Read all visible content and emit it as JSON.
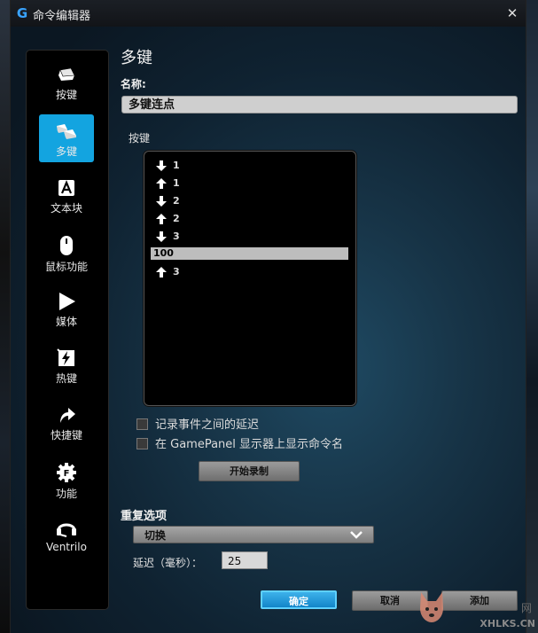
{
  "window": {
    "title": "命令编辑器",
    "close_glyph": "✕",
    "logo_glyph": "G"
  },
  "sidebar": {
    "items": [
      {
        "label": "按键",
        "icon": "key-icon",
        "active": false
      },
      {
        "label": "多键",
        "icon": "multikey-icon",
        "active": true
      },
      {
        "label": "文本块",
        "icon": "text-block-icon",
        "active": false
      },
      {
        "label": "鼠标功能",
        "icon": "mouse-icon",
        "active": false
      },
      {
        "label": "媒体",
        "icon": "play-icon",
        "active": false
      },
      {
        "label": "热键",
        "icon": "hotkey-icon",
        "active": false
      },
      {
        "label": "快捷键",
        "icon": "shortcut-arrow-icon",
        "active": false
      },
      {
        "label": "功能",
        "icon": "function-gear-icon",
        "active": false
      },
      {
        "label": "Ventrilo",
        "icon": "headset-icon",
        "active": false
      }
    ]
  },
  "main": {
    "section_title": "多键",
    "name_label": "名称:",
    "name_value": "多键连点",
    "keys_label": "按键",
    "keys": [
      {
        "dir": "down",
        "key": "1"
      },
      {
        "dir": "up",
        "key": "1"
      },
      {
        "dir": "down",
        "key": "2"
      },
      {
        "dir": "up",
        "key": "2"
      },
      {
        "dir": "down",
        "key": "3"
      },
      {
        "dir": "delay",
        "key": "100"
      },
      {
        "dir": "up",
        "key": "3"
      }
    ],
    "checkbox_record_delay": "记录事件之间的延迟",
    "checkbox_show_name": "在 GamePanel 显示器上显示命令名",
    "record_button": "开始录制",
    "repeat_label": "重复选项",
    "repeat_value": "切换",
    "delay_label": "延迟（毫秒）：",
    "delay_value": "25"
  },
  "footer": {
    "ok": "确定",
    "cancel": "取消",
    "add": "添加"
  },
  "watermark": {
    "top": "网",
    "bottom": "XHLKS.CN"
  },
  "colors": {
    "accent": "#13a4e0",
    "ok_button": "#1e97d8"
  }
}
